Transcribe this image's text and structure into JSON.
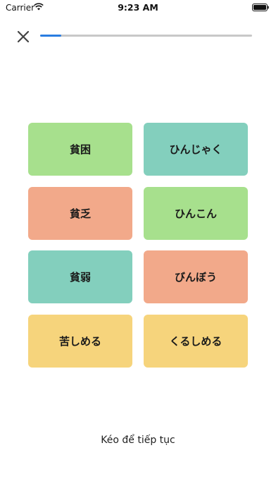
{
  "status_bar": {
    "carrier": "Carrier",
    "time": "9:23 AM"
  },
  "progress": {
    "fraction": 0.1,
    "color": "#2a7de1",
    "track_color": "#c8c8c8"
  },
  "colors": {
    "green": "#a7e08d",
    "teal": "#83cfbd",
    "salmon": "#f2a98a",
    "yellow": "#f6d47c"
  },
  "cards": {
    "r1_left": {
      "text": "貧困",
      "color": "green"
    },
    "r1_right": {
      "text": "ひんじゃく",
      "color": "teal"
    },
    "r2_left": {
      "text": "貧乏",
      "color": "salmon"
    },
    "r2_right": {
      "text": "ひんこん",
      "color": "green"
    },
    "r3_left": {
      "text": "貧弱",
      "color": "teal"
    },
    "r3_right": {
      "text": "びんぼう",
      "color": "salmon"
    },
    "r4_left": {
      "text": "苦しめる",
      "color": "yellow"
    },
    "r4_right": {
      "text": "くるしめる",
      "color": "yellow"
    }
  },
  "footer": {
    "hint": "Kéo để tiếp tục"
  },
  "icons": {
    "close": "close-icon",
    "wifi": "wifi-icon",
    "battery": "battery-icon"
  }
}
